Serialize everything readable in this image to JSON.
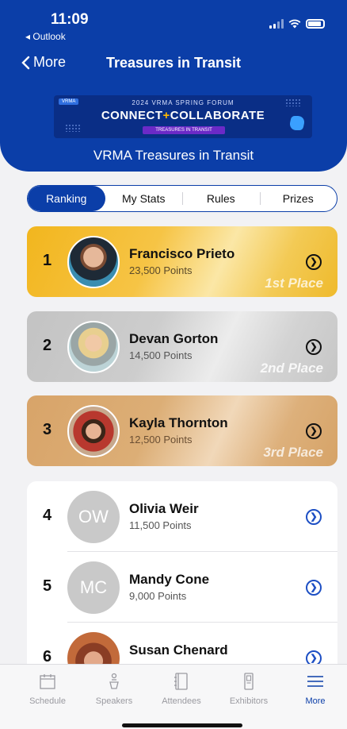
{
  "status_bar": {
    "time": "11:09",
    "back_app": "◂ Outlook"
  },
  "nav": {
    "back_label": "More",
    "title": "Treasures in Transit"
  },
  "banner": {
    "tag": "VRMA",
    "subtitle": "2024 VRMA SPRING FORUM",
    "main_left": "CONNECT",
    "main_plus": "+",
    "main_right": "COLLABORATE",
    "strip": "TREASURES IN TRANSIT"
  },
  "event_name": "VRMA Treasures in Transit",
  "tabs_segment": [
    {
      "label": "Ranking",
      "active": true
    },
    {
      "label": "My Stats",
      "active": false
    },
    {
      "label": "Rules",
      "active": false
    },
    {
      "label": "Prizes",
      "active": false
    }
  ],
  "leaders": [
    {
      "rank": "1",
      "name": "Francisco Prieto",
      "points": "23,500 Points",
      "place": "1st Place"
    },
    {
      "rank": "2",
      "name": "Devan Gorton",
      "points": "14,500 Points",
      "place": "2nd Place"
    },
    {
      "rank": "3",
      "name": "Kayla Thornton",
      "points": "12,500 Points",
      "place": "3rd Place"
    }
  ],
  "others": [
    {
      "rank": "4",
      "name": "Olivia Weir",
      "points": "11,500 Points",
      "initials": "OW"
    },
    {
      "rank": "5",
      "name": "Mandy Cone",
      "points": "9,000 Points",
      "initials": "MC"
    },
    {
      "rank": "6",
      "name": "Susan Chenard",
      "points": "",
      "initials": ""
    }
  ],
  "bottom_tabs": [
    {
      "label": "Schedule",
      "icon": "calendar-icon"
    },
    {
      "label": "Speakers",
      "icon": "speaker-icon"
    },
    {
      "label": "Attendees",
      "icon": "book-icon"
    },
    {
      "label": "Exhibitors",
      "icon": "booth-icon"
    },
    {
      "label": "More",
      "icon": "menu-icon",
      "active": true
    }
  ],
  "colors": {
    "brand": "#0b3ea8",
    "gold": "#f2b61e",
    "silver": "#c8c8c8",
    "bronze": "#d8a469"
  }
}
